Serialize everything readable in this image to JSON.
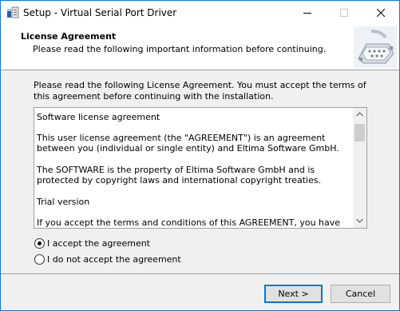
{
  "window": {
    "title": "Setup - Virtual Serial Port Driver",
    "icon": "setup-app-icon",
    "controls": {
      "minimize": "minimize-icon",
      "maximize": "maximize-icon",
      "close": "close-icon"
    }
  },
  "header": {
    "title": "License Agreement",
    "subtitle": "Please read the following important information before continuing.",
    "logo": "serial-port-connector-icon"
  },
  "intro": "Please read the following License Agreement. You must accept the terms of this agreement before continuing with the installation.",
  "license": {
    "paragraphs": [
      "Software license agreement",
      "This user license agreement (the \"AGREEMENT\") is an agreement between you (individual or single entity) and Eltima Software GmbH.",
      "The SOFTWARE is the property of Eltima Software GmbH and is protected by copyright laws and international copyright treaties.",
      "Trial version",
      "If you accept the terms and conditions of this AGREEMENT, you have certain"
    ]
  },
  "options": {
    "accept": {
      "label": "I accept the agreement",
      "selected": true
    },
    "decline": {
      "label": "I do not accept the agreement",
      "selected": false
    }
  },
  "buttons": {
    "next": "Next >",
    "cancel": "Cancel"
  },
  "colors": {
    "window_border": "#1a73c8",
    "default_button_border": "#0078d7",
    "dialog_background": "#f0f0f0"
  }
}
